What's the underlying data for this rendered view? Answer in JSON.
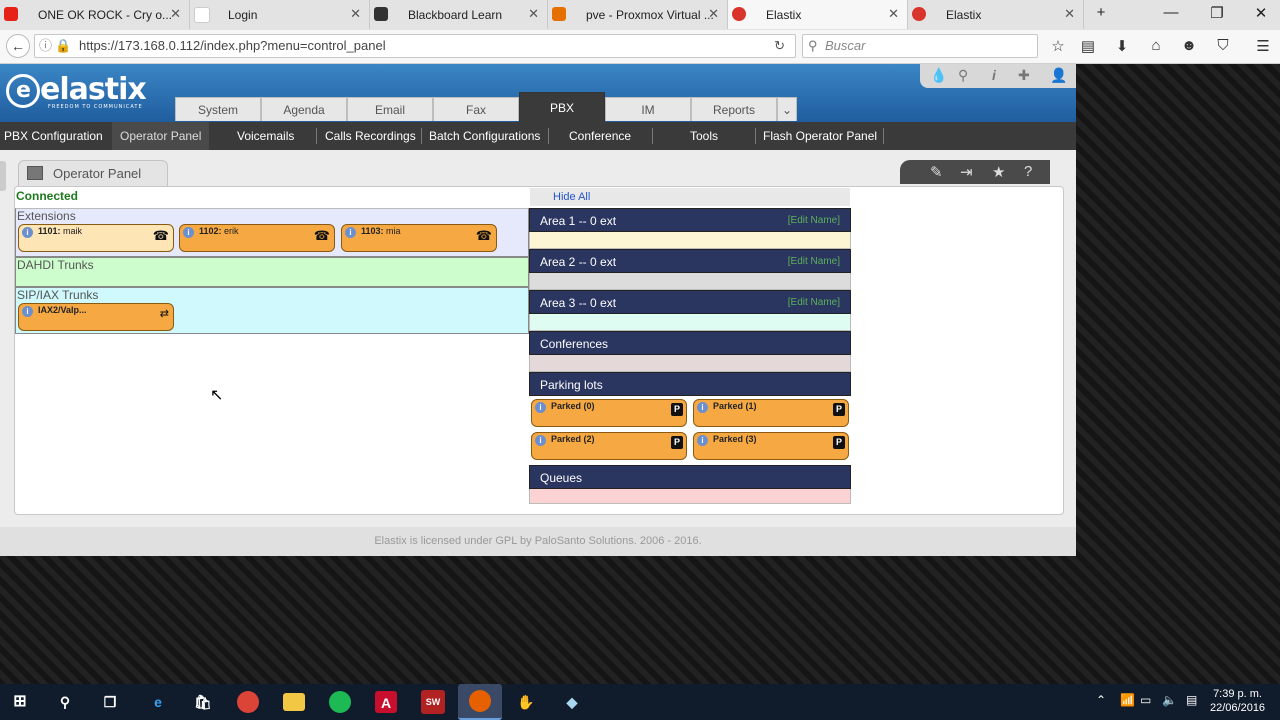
{
  "browser": {
    "tabs": [
      {
        "label": "ONE OK ROCK - Cry o...",
        "icon": "youtube-icon",
        "color": "#e62117"
      },
      {
        "label": "Login",
        "icon": "page-icon",
        "color": "#cc4444"
      },
      {
        "label": "Blackboard Learn",
        "icon": "blackboard-icon",
        "color": "#333333"
      },
      {
        "label": "pve - Proxmox Virtual ...",
        "icon": "proxmox-icon",
        "color": "#e57000"
      },
      {
        "label": "Elastix",
        "icon": "elastix-icon",
        "color": "#d9342b"
      },
      {
        "label": "Elastix",
        "icon": "elastix-icon",
        "color": "#d9342b"
      }
    ],
    "url": "https://173.168.0.112/index.php?menu=control_panel",
    "search_placeholder": "Buscar"
  },
  "app": {
    "logo": "elastix",
    "logo_tagline": "FREEDOM TO COMMUNICATE",
    "main_tabs": [
      "System",
      "Agenda",
      "Email",
      "Fax",
      "PBX",
      "IM",
      "Reports"
    ],
    "active_main_tab": "PBX",
    "sub_menu": [
      "PBX Configuration",
      "Operator Panel",
      "Voicemails",
      "Calls Recordings",
      "Batch Configurations",
      "Conference",
      "Tools",
      "Flash Operator Panel"
    ],
    "active_sub_menu": "Operator Panel",
    "panel_title": "Operator Panel",
    "status": "Connected",
    "hide_all": "Hide All",
    "sections": {
      "extensions": {
        "label": "Extensions",
        "items": [
          {
            "num": "1101:",
            "name": "maik"
          },
          {
            "num": "1102:",
            "name": "erik"
          },
          {
            "num": "1103:",
            "name": "mia"
          }
        ]
      },
      "dahdi": {
        "label": "DAHDI Trunks"
      },
      "sip": {
        "label": "SIP/IAX Trunks",
        "items": [
          {
            "name": "IAX2/Valp..."
          }
        ]
      }
    },
    "areas": [
      {
        "title": "Area 1 -- 0 ext",
        "edit": "[Edit Name]",
        "color": "#fdf6d4"
      },
      {
        "title": "Area 2 -- 0 ext",
        "edit": "[Edit Name]",
        "color": "#dcdcdc"
      },
      {
        "title": "Area 3 -- 0 ext",
        "edit": "[Edit Name]",
        "color": "#dffcf2"
      }
    ],
    "conferences": {
      "title": "Conferences"
    },
    "parking": {
      "title": "Parking lots",
      "items": [
        "Parked (0)",
        "Parked (1)",
        "Parked (2)",
        "Parked (3)"
      ]
    },
    "queues": {
      "title": "Queues"
    },
    "footer": "Elastix is licensed under GPL by PaloSanto Solutions. 2006 - 2016."
  },
  "taskbar": {
    "time": "7:39 p. m.",
    "date": "22/06/2016"
  }
}
